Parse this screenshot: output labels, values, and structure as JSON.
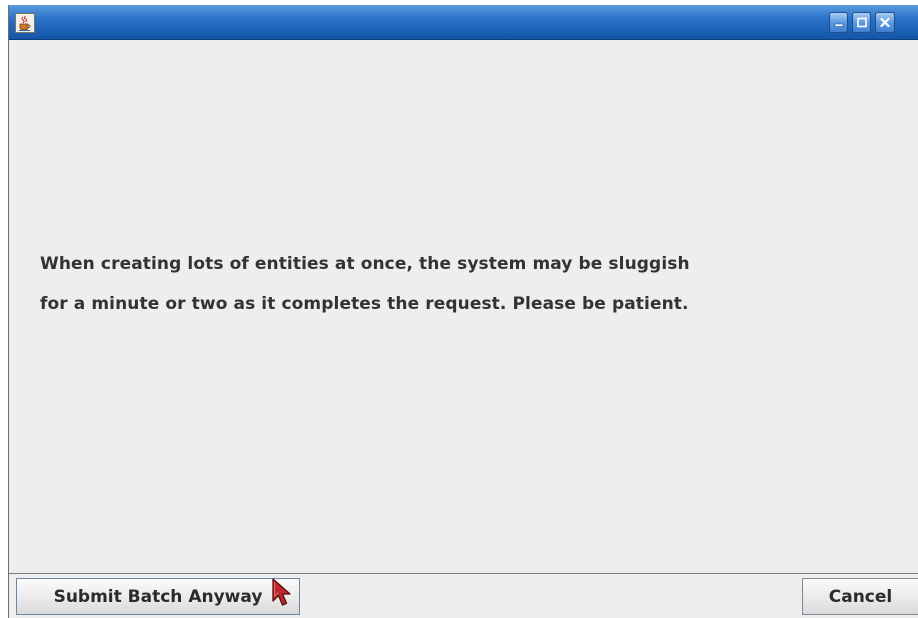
{
  "window": {
    "title": ""
  },
  "dialog": {
    "message_line_1": "When creating lots of entities at once, the system may be sluggish",
    "message_line_2": "for a minute or two as it completes the request.  Please be patient."
  },
  "buttons": {
    "submit_label": "Submit Batch Anyway",
    "cancel_label": "Cancel"
  },
  "icons": {
    "app": "java-cup-icon",
    "minimize": "minimize-icon",
    "maximize": "maximize-icon",
    "close": "close-icon",
    "cursor": "mouse-pointer-icon"
  },
  "colors": {
    "titlebar": "#2a72c8",
    "background": "#eeeeee",
    "text": "#333333",
    "cursor": "#c0272d"
  }
}
